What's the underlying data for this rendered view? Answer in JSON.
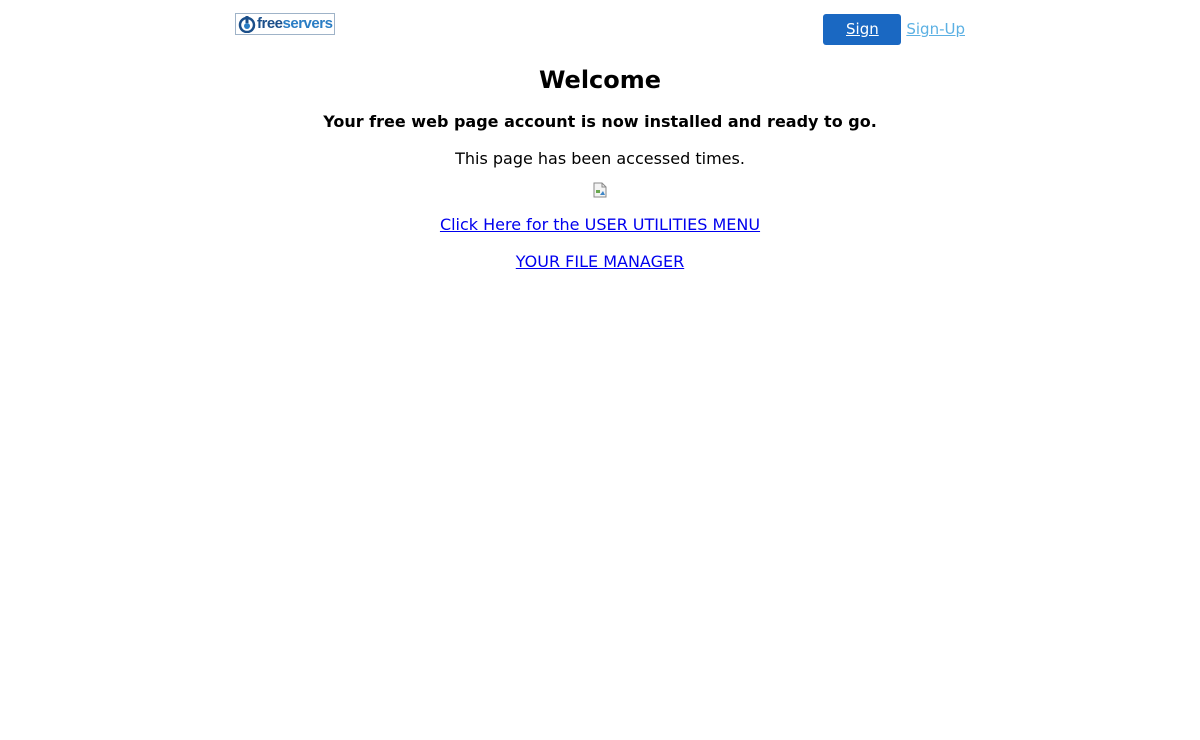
{
  "header": {
    "logo": {
      "text_free": "free",
      "text_servers": "servers",
      "icon": "freeservers-logo-icon"
    },
    "signin_label": "Sign In",
    "signup_label": "Sign-Up"
  },
  "main": {
    "title": "Welcome",
    "subtitle": "Your free web page account is now installed and ready to go.",
    "counter_text": "This page has been accessed times.",
    "counter_image": "broken-image-icon",
    "links": [
      {
        "label": "Click Here for the USER UTILITIES MENU"
      },
      {
        "label": "YOUR FILE MANAGER"
      }
    ]
  },
  "colors": {
    "signin_bg": "#1a68c2",
    "signup_text": "#5bb0e3",
    "link": "#0000ee",
    "logo_dark": "#1b4f8a",
    "logo_light": "#2a7dc4"
  }
}
